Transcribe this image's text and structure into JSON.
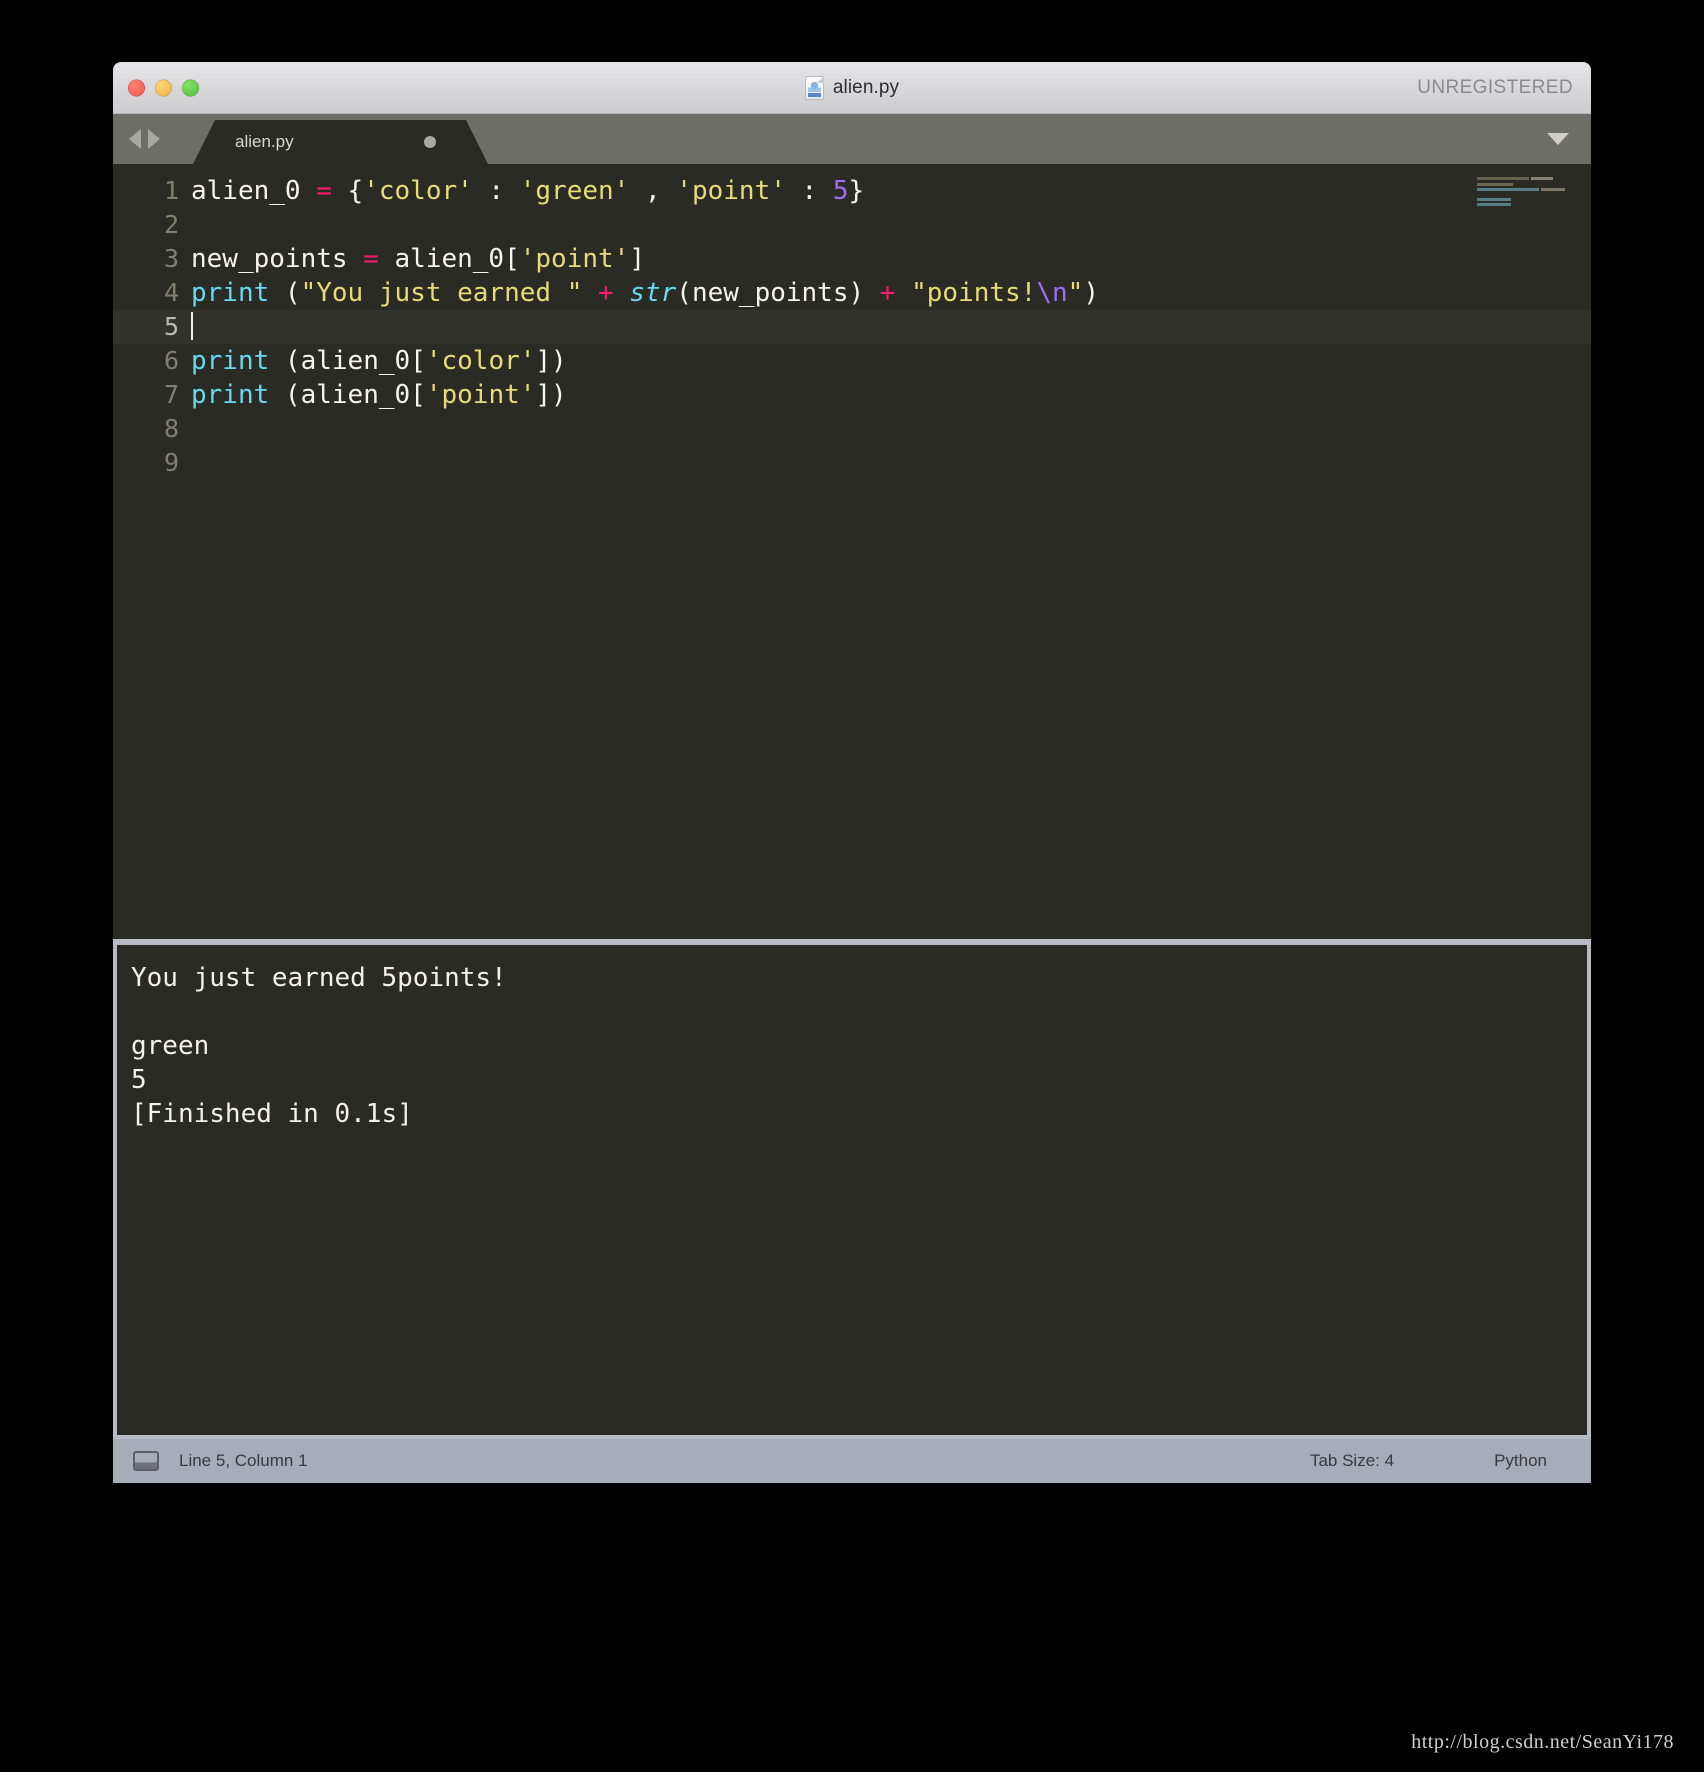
{
  "window": {
    "title": "alien.py",
    "file_icon": "python-file-icon",
    "license_status": "UNREGISTERED",
    "traffic_lights": [
      "close-button",
      "minimize-button",
      "maximize-button"
    ]
  },
  "tabbar": {
    "nav_back": "◀",
    "nav_forward": "▶",
    "tab_label": "alien.py",
    "modified_indicator": "unsaved-dot",
    "menu_icon": "chevron-down-icon"
  },
  "editor": {
    "language": "Python",
    "cursor_line": 5,
    "lines": [
      {
        "n": "1",
        "tokens": [
          {
            "t": "alien_0 ",
            "c": "t-plain"
          },
          {
            "t": "=",
            "c": "t-op"
          },
          {
            "t": " {",
            "c": "t-plain"
          },
          {
            "t": "'color'",
            "c": "t-str"
          },
          {
            "t": " : ",
            "c": "t-plain"
          },
          {
            "t": "'green'",
            "c": "t-str"
          },
          {
            "t": " , ",
            "c": "t-plain"
          },
          {
            "t": "'point'",
            "c": "t-str"
          },
          {
            "t": " : ",
            "c": "t-plain"
          },
          {
            "t": "5",
            "c": "t-num"
          },
          {
            "t": "}",
            "c": "t-plain"
          }
        ]
      },
      {
        "n": "2",
        "tokens": []
      },
      {
        "n": "3",
        "tokens": [
          {
            "t": "new_points ",
            "c": "t-plain"
          },
          {
            "t": "=",
            "c": "t-op"
          },
          {
            "t": " alien_0[",
            "c": "t-plain"
          },
          {
            "t": "'point'",
            "c": "t-str"
          },
          {
            "t": "]",
            "c": "t-plain"
          }
        ]
      },
      {
        "n": "4",
        "tokens": [
          {
            "t": "print",
            "c": "t-fn"
          },
          {
            "t": " (",
            "c": "t-plain"
          },
          {
            "t": "\"You just earned \"",
            "c": "t-str"
          },
          {
            "t": " ",
            "c": "t-plain"
          },
          {
            "t": "+",
            "c": "t-op"
          },
          {
            "t": " ",
            "c": "t-plain"
          },
          {
            "t": "str",
            "c": "t-italic"
          },
          {
            "t": "(new_points) ",
            "c": "t-plain"
          },
          {
            "t": "+",
            "c": "t-op"
          },
          {
            "t": " ",
            "c": "t-plain"
          },
          {
            "t": "\"points!",
            "c": "t-str"
          },
          {
            "t": "\\n",
            "c": "t-esc"
          },
          {
            "t": "\"",
            "c": "t-str"
          },
          {
            "t": ")",
            "c": "t-plain"
          }
        ]
      },
      {
        "n": "5",
        "tokens": [],
        "active": true,
        "caret": true
      },
      {
        "n": "6",
        "tokens": [
          {
            "t": "print",
            "c": "t-fn"
          },
          {
            "t": " (alien_0[",
            "c": "t-plain"
          },
          {
            "t": "'color'",
            "c": "t-str"
          },
          {
            "t": "])",
            "c": "t-plain"
          }
        ]
      },
      {
        "n": "7",
        "tokens": [
          {
            "t": "print",
            "c": "t-fn"
          },
          {
            "t": " (alien_0[",
            "c": "t-plain"
          },
          {
            "t": "'point'",
            "c": "t-str"
          },
          {
            "t": "])",
            "c": "t-plain"
          }
        ]
      },
      {
        "n": "8",
        "tokens": []
      },
      {
        "n": "9",
        "tokens": []
      }
    ]
  },
  "console": {
    "output": "You just earned 5points!\n\ngreen\n5\n[Finished in 0.1s]"
  },
  "statusbar": {
    "panel_toggle_icon": "panel-toggle-icon",
    "position": "Line 5, Column 1",
    "tab_size": "Tab Size: 4",
    "syntax": "Python"
  },
  "watermark": "http://blog.csdn.net/SeanYi178",
  "colors": {
    "editor_bg": "#2b2b26",
    "active_line": "#33332d",
    "string": "#e6db74",
    "operator": "#f6196e",
    "number": "#a06ef5",
    "function": "#66d9ef",
    "foreground": "#f2f2ea",
    "tabbar": "#6e6e68",
    "statusbar": "#a7adb8"
  }
}
